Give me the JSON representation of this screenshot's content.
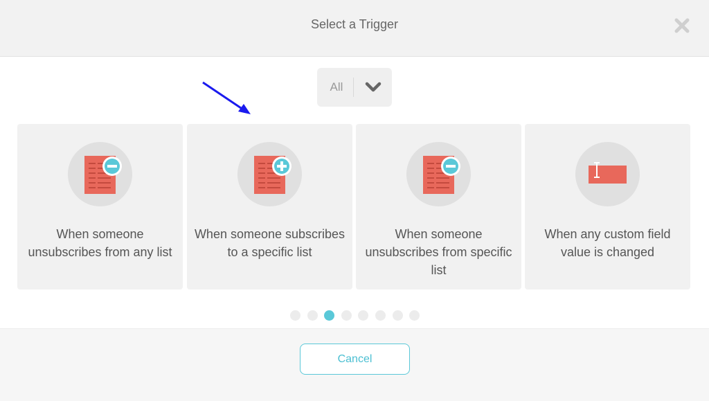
{
  "modal": {
    "title": "Select a Trigger",
    "close_icon": "close-x-icon"
  },
  "filter": {
    "selected": "All",
    "icon": "chevron-down-icon"
  },
  "cards": [
    {
      "icon": "list-minus-icon",
      "label": "When someone unsubscribes from any list"
    },
    {
      "icon": "list-plus-icon",
      "label": "When someone subscribes to a specific list"
    },
    {
      "icon": "list-minus-icon",
      "label": "When someone unsubscribes from specific list"
    },
    {
      "icon": "text-field-icon",
      "label": "When any custom field value is changed"
    }
  ],
  "pagination": {
    "total": 8,
    "active_index": 2
  },
  "footer": {
    "cancel_label": "Cancel"
  },
  "colors": {
    "accent": "#5ac8d8",
    "doc_red": "#e8685b",
    "annotation_arrow": "#1a1aee"
  }
}
